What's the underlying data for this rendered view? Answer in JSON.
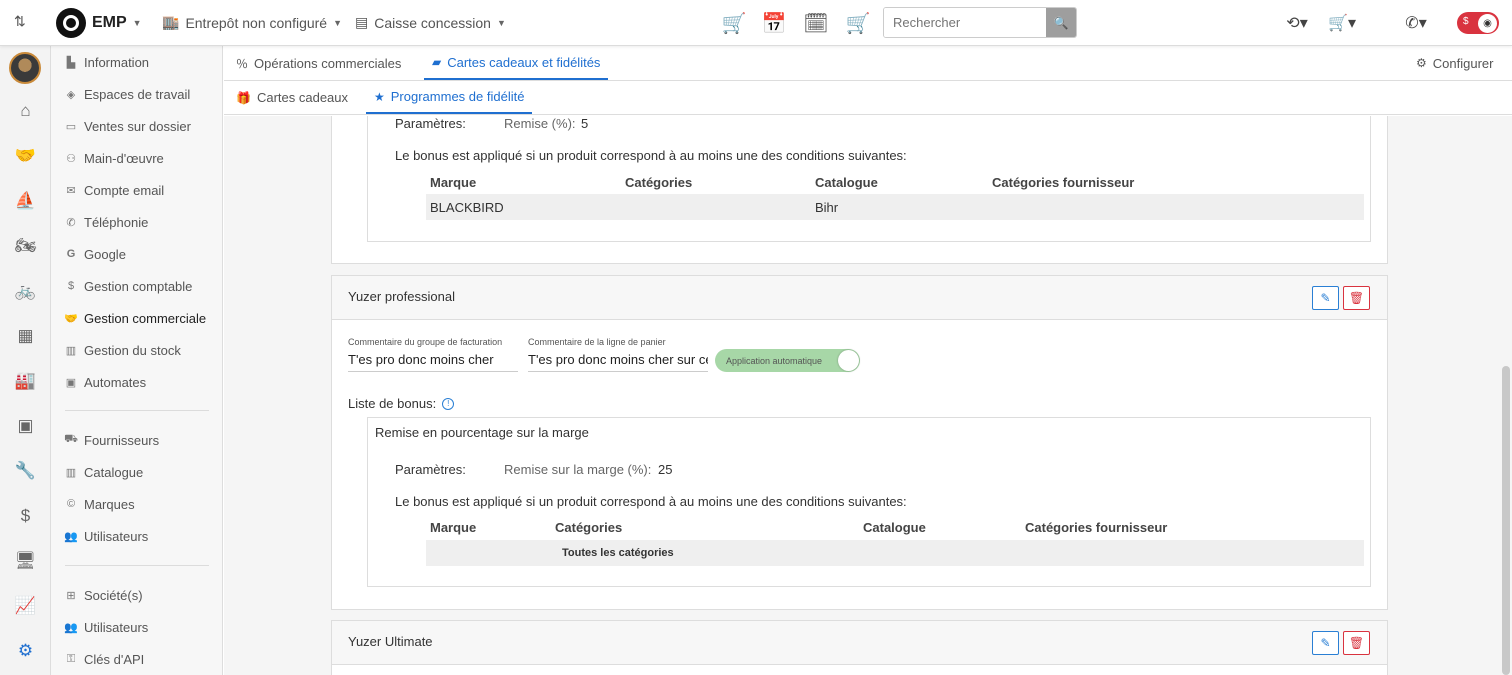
{
  "topbar": {
    "brand": "EMP",
    "warehouse": "Entrepôt non configuré",
    "register": "Caisse concession",
    "search_placeholder": "Rechercher"
  },
  "menu": {
    "items": [
      {
        "label": "Information",
        "icon": "factory-icon"
      },
      {
        "label": "Espaces de travail",
        "icon": "layers-icon"
      },
      {
        "label": "Ventes sur dossier",
        "icon": "folder-star-icon"
      },
      {
        "label": "Main-d'œuvre",
        "icon": "users-cog-icon"
      },
      {
        "label": "Compte email",
        "icon": "envelope-icon"
      },
      {
        "label": "Téléphonie",
        "icon": "phone-icon"
      },
      {
        "label": "Google",
        "icon": "google-icon"
      },
      {
        "label": "Gestion comptable",
        "icon": "dollar-icon"
      },
      {
        "label": "Gestion commerciale",
        "icon": "handshake-icon"
      },
      {
        "label": "Gestion du stock",
        "icon": "warehouse-icon"
      },
      {
        "label": "Automates",
        "icon": "robot-icon"
      }
    ],
    "items2": [
      {
        "label": "Fournisseurs",
        "icon": "truck-icon"
      },
      {
        "label": "Catalogue",
        "icon": "books-icon"
      },
      {
        "label": "Marques",
        "icon": "copyright-icon"
      },
      {
        "label": "Utilisateurs",
        "icon": "users-icon"
      }
    ],
    "items3": [
      {
        "label": "Société(s)",
        "icon": "sitemap-icon"
      },
      {
        "label": "Utilisateurs",
        "icon": "users-icon"
      },
      {
        "label": "Clés d'API",
        "icon": "key-icon"
      }
    ]
  },
  "tabs": {
    "primary": [
      "Opérations commerciales",
      "Cartes cadeaux et fidélités"
    ],
    "configure": "Configurer",
    "secondary": [
      "Cartes cadeaux",
      "Programmes de fidélité"
    ]
  },
  "block1": {
    "params_label": "Paramètres:",
    "params_value_label": "Remise (%):",
    "params_value": "5",
    "conditions_text": "Le bonus est appliqué si un produit correspond à au moins une des conditions suivantes:",
    "headers": [
      "Marque",
      "Catégories",
      "Catalogue",
      "Catégories fournisseur"
    ],
    "row": [
      "BLACKBIRD",
      "",
      "Bihr",
      ""
    ]
  },
  "card2": {
    "title": "Yuzer professional",
    "billing_comment_label": "Commentaire du groupe de facturation",
    "billing_comment_value": "T'es pro donc moins cher",
    "cart_comment_label": "Commentaire de la ligne de panier",
    "cart_comment_value": "T'es pro donc moins cher sur ce",
    "auto_apply_label": "Application automatique",
    "bonus_list_label": "Liste de bonus:",
    "bonus_title": "Remise en pourcentage sur la marge",
    "params_label": "Paramètres:",
    "params_value_label": "Remise sur la marge (%):",
    "params_value": "25",
    "conditions_text": "Le bonus est appliqué si un produit correspond à au moins une des conditions suivantes:",
    "headers": [
      "Marque",
      "Catégories",
      "Catalogue",
      "Catégories fournisseur"
    ],
    "row": [
      "",
      "Toutes les catégories",
      "",
      ""
    ]
  },
  "card3": {
    "title": "Yuzer Ultimate"
  }
}
